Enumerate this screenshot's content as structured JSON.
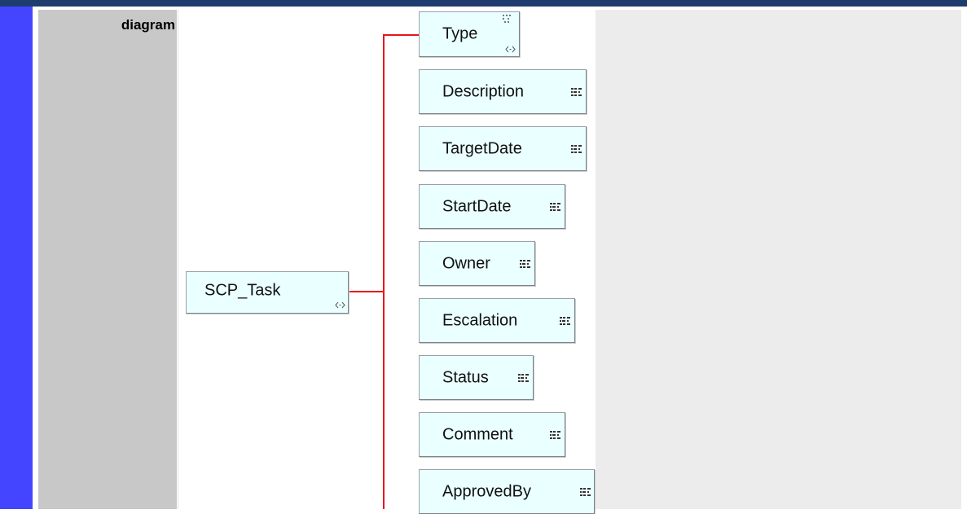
{
  "row": {
    "label": "diagram"
  },
  "diagram": {
    "root": {
      "name": "SCP_Task",
      "icon": "complex-type-icon"
    },
    "children": [
      {
        "name": "Type",
        "icon": "complex-type-icon",
        "extra_icon": "attribute-icon"
      },
      {
        "name": "Description",
        "icon": "element-icon"
      },
      {
        "name": "TargetDate",
        "icon": "element-icon"
      },
      {
        "name": "StartDate",
        "icon": "element-icon"
      },
      {
        "name": "Owner",
        "icon": "element-icon"
      },
      {
        "name": "Escalation",
        "icon": "element-icon"
      },
      {
        "name": "Status",
        "icon": "element-icon"
      },
      {
        "name": "Comment",
        "icon": "element-icon"
      },
      {
        "name": "ApprovedBy",
        "icon": "element-icon"
      }
    ],
    "colors": {
      "connector": "#e8151b",
      "node_fill": "#eaffff",
      "node_border": "#9aa0a4",
      "left_stripe": "#4446ff",
      "top_bar": "#1e3d6e",
      "label_cell": "#c8c8c8",
      "right_cell": "#ececec"
    }
  }
}
